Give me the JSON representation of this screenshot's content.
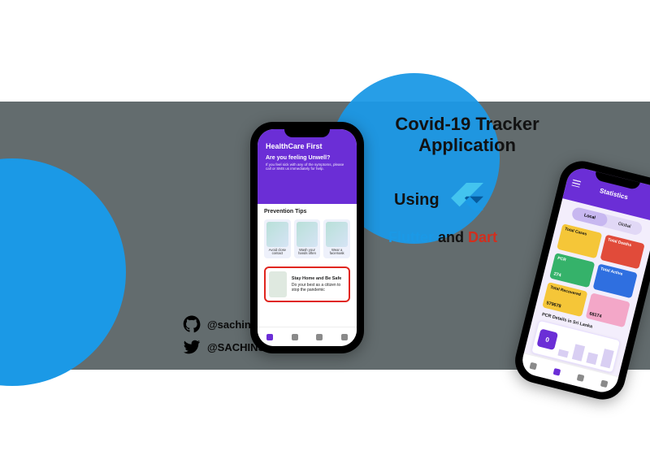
{
  "banner": {
    "title_line1": "Covid-19 Tracker",
    "title_line2": "Application",
    "using_label": "Using",
    "tech": {
      "flutter": "Flutter",
      "and": "and",
      "dart": "Dart"
    }
  },
  "social": {
    "github_handle": "@sachin96Boy",
    "twitter_handle": "@SACHINSUPUNTHAK"
  },
  "phone_home": {
    "brand": "HealthCare First",
    "question": "Are you feeling Unwell?",
    "subtext": "If you feel sick with any of the symptoms, please call or SMS us immediately for help.",
    "tips_heading": "Prevention Tips",
    "tips": [
      {
        "label": "Avoid close contact"
      },
      {
        "label": "Wash your hands often"
      },
      {
        "label": "Wear a facemask"
      }
    ],
    "safe_title": "Stay Home and Be Safe",
    "safe_sub": "Do your best as a citizen to stop the pandemic"
  },
  "phone_stats": {
    "title": "Statistics",
    "toggle": {
      "local": "Local",
      "global": "Global"
    },
    "cards": {
      "total_cases": {
        "label": "Total Cases",
        "value": ""
      },
      "total_deaths": {
        "label": "Total Deaths",
        "value": ""
      },
      "pcr": {
        "label": "PCR",
        "value": "274"
      },
      "total_active": {
        "label": "Total Active",
        "value": ""
      },
      "total_recovered": {
        "label": "Total Recovered",
        "value": "579678"
      },
      "blank": {
        "label": "",
        "value": "68174"
      }
    },
    "pcr_section": "PCR Details in Sri Lanka",
    "pcr_badge": "0"
  },
  "colors": {
    "accent_blue": "#1b99e6",
    "band_gray": "#636c6e",
    "flutter_purple": "#6b2ed6"
  }
}
